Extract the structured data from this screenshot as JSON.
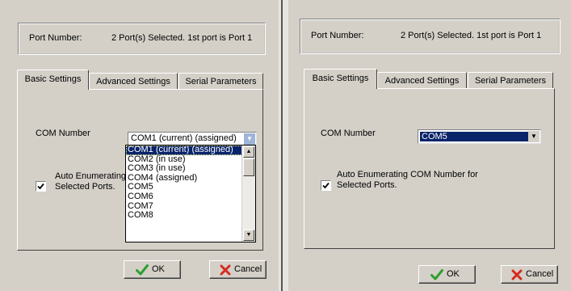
{
  "dialogs": [
    {
      "port_number_label": "Port Number:",
      "port_number_value": "2 Port(s) Selected. 1st port is Port 1",
      "tabs": [
        "Basic Settings",
        "Advanced Settings",
        "Serial Parameters"
      ],
      "active_tab": "Basic Settings",
      "com_number_label": "COM Number",
      "com_selected": "COM1 (current) (assigned)",
      "com_options_visible": [
        "COM1 (current) (assigned)",
        "COM2 (in use)",
        "COM3 (in use)",
        "COM4 (assigned)",
        "COM5",
        "COM6",
        "COM7",
        "COM8"
      ],
      "auto_enum_text_line1": "Auto Enumerating",
      "auto_enum_text_line2": "Selected Ports.",
      "auto_enum_checked": true,
      "ok_label": "OK",
      "cancel_label": "Cancel"
    },
    {
      "port_number_label": "Port Number:",
      "port_number_value": "2 Port(s) Selected. 1st port is Port 1",
      "tabs": [
        "Basic Settings",
        "Advanced Settings",
        "Serial Parameters"
      ],
      "active_tab": "Basic Settings",
      "com_number_label": "COM Number",
      "com_selected": "COM5",
      "auto_enum_text_line1": "Auto Enumerating COM Number for",
      "auto_enum_text_line2": "Selected Ports.",
      "auto_enum_checked": true,
      "ok_label": "OK",
      "cancel_label": "Cancel"
    }
  ],
  "colors": {
    "selection": "#0a246a",
    "ok_check": "#2e9e2e",
    "cancel_x": "#d62a1e"
  },
  "icons": {
    "ok": "green-check-icon",
    "cancel": "red-x-icon",
    "combo_arrow": "chevron-down-icon",
    "checkbox": "checkmark-icon"
  }
}
